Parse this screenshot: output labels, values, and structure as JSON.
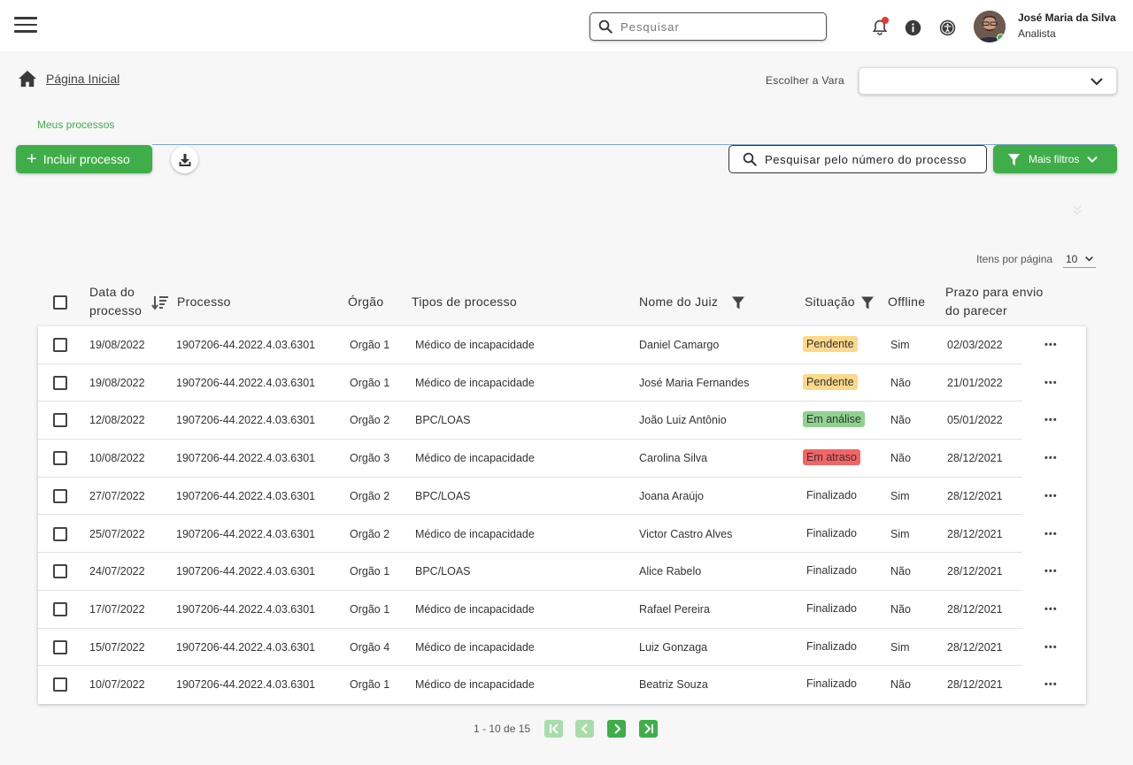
{
  "header": {
    "search_placeholder": "Pesquisar",
    "user_name": "José Maria da Silva",
    "user_role": "Analista"
  },
  "breadcrumb": {
    "home_label": "Página Inicial"
  },
  "vara": {
    "label": "Escolher a Vara",
    "value": ""
  },
  "tabs": {
    "active": "Meus processos"
  },
  "toolbar": {
    "add_label": "Incluir processo",
    "search_label": "Pesquisar pelo número do processo",
    "filters_label": "Mais filtros"
  },
  "pagination": {
    "per_page_label": "Itens por página",
    "per_page_value": "10",
    "range_text": "1 - 10 de 15"
  },
  "table": {
    "headers": {
      "date": [
        "Data do",
        "processo"
      ],
      "process": "Processo",
      "organ": "Órgão",
      "type": "Tipos de processo",
      "judge": "Nome do Juiz",
      "status": "Situação",
      "offline": "Offline",
      "deadline": [
        "Prazo para envio",
        "do parecer"
      ]
    },
    "rows": [
      {
        "date": "19/08/2022",
        "process": "1907206-44.2022.4.03.6301",
        "organ": "Orgão 1",
        "type": "Médico de incapacidade",
        "judge": "Daniel Camargo",
        "status": "Pendente",
        "offline": "Sim",
        "deadline": "02/03/2022"
      },
      {
        "date": "19/08/2022",
        "process": "1907206-44.2022.4.03.6301",
        "organ": "Orgão 1",
        "type": "Médico de incapacidade",
        "judge": "José Maria Fernandes",
        "status": "Pendente",
        "offline": "Não",
        "deadline": "21/01/2022"
      },
      {
        "date": "12/08/2022",
        "process": "1907206-44.2022.4.03.6301",
        "organ": "Orgão 2",
        "type": "BPC/LOAS",
        "judge": "João Luiz Antônio",
        "status": "Em análise",
        "offline": "Não",
        "deadline": "05/01/2022"
      },
      {
        "date": "10/08/2022",
        "process": "1907206-44.2022.4.03.6301",
        "organ": "Orgão 3",
        "type": "Médico de incapacidade",
        "judge": "Carolina Silva",
        "status": "Em atraso",
        "offline": "Não",
        "deadline": "28/12/2021"
      },
      {
        "date": "27/07/2022",
        "process": "1907206-44.2022.4.03.6301",
        "organ": "Orgão 2",
        "type": "BPC/LOAS",
        "judge": "Joana Araújo",
        "status": "Finalizado",
        "offline": "Sim",
        "deadline": "28/12/2021"
      },
      {
        "date": "25/07/2022",
        "process": "1907206-44.2022.4.03.6301",
        "organ": "Orgão 2",
        "type": "Médico de incapacidade",
        "judge": "Victor Castro Alves",
        "status": "Finalizado",
        "offline": "Sim",
        "deadline": "28/12/2021"
      },
      {
        "date": "24/07/2022",
        "process": "1907206-44.2022.4.03.6301",
        "organ": "Orgão 1",
        "type": "BPC/LOAS",
        "judge": "Alice Rabelo",
        "status": "Finalizado",
        "offline": "Não",
        "deadline": "28/12/2021"
      },
      {
        "date": "17/07/2022",
        "process": "1907206-44.2022.4.03.6301",
        "organ": "Orgão 1",
        "type": "Médico de incapacidade",
        "judge": "Rafael Pereira",
        "status": "Finalizado",
        "offline": "Não",
        "deadline": "28/12/2021"
      },
      {
        "date": "15/07/2022",
        "process": "1907206-44.2022.4.03.6301",
        "organ": "Orgão 4",
        "type": "Médico de incapacidade",
        "judge": "Luiz Gonzaga",
        "status": "Finalizado",
        "offline": "Sim",
        "deadline": "28/12/2021"
      },
      {
        "date": "10/07/2022",
        "process": "1907206-44.2022.4.03.6301",
        "organ": "Orgão 1",
        "type": "Médico de incapacidade",
        "judge": "Beatriz Souza",
        "status": "Finalizado",
        "offline": "Não",
        "deadline": "28/12/2021"
      }
    ]
  },
  "status_colors": {
    "Pendente": "#fcd98a",
    "Em análise": "#8fd28f",
    "Em atraso": "#f46464",
    "Finalizado": "transparent"
  },
  "colors": {
    "accent": "#3fae49",
    "accent_light": "#a8ddaa",
    "notification": "#e53935"
  },
  "icons": [
    "menu-icon",
    "search-icon",
    "bell-icon",
    "info-icon",
    "accessibility-icon",
    "home-icon",
    "chevron-down-icon",
    "plus-icon",
    "download-icon",
    "filter-icon",
    "sort-icon",
    "more-icon",
    "first-page-icon",
    "prev-page-icon",
    "next-page-icon",
    "last-page-icon"
  ]
}
